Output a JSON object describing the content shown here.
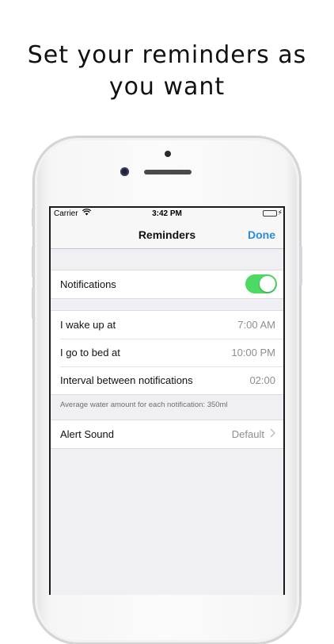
{
  "headline": {
    "line1": "Set your reminders as",
    "line2": "you want"
  },
  "status_bar": {
    "carrier": "Carrier",
    "time": "3:42 PM",
    "wifi_icon": "wifi-icon",
    "battery_icon": "battery-charging-icon",
    "battery_color": "#4cd964"
  },
  "nav": {
    "title": "Reminders",
    "done_label": "Done",
    "done_color": "#2a8bd6"
  },
  "settings": {
    "notifications": {
      "label": "Notifications",
      "enabled": true,
      "toggle_color": "#4cd964"
    },
    "wake_up": {
      "label": "I wake up at",
      "value": "7:00 AM"
    },
    "bed": {
      "label": "I go to bed at",
      "value": "10:00 PM"
    },
    "interval": {
      "label": "Interval between notifications",
      "value": "02:00"
    },
    "footnote": "Average water amount for each notification:  350ml",
    "alert_sound": {
      "label": "Alert Sound",
      "value": "Default",
      "icon": "chevron-right-icon"
    }
  }
}
